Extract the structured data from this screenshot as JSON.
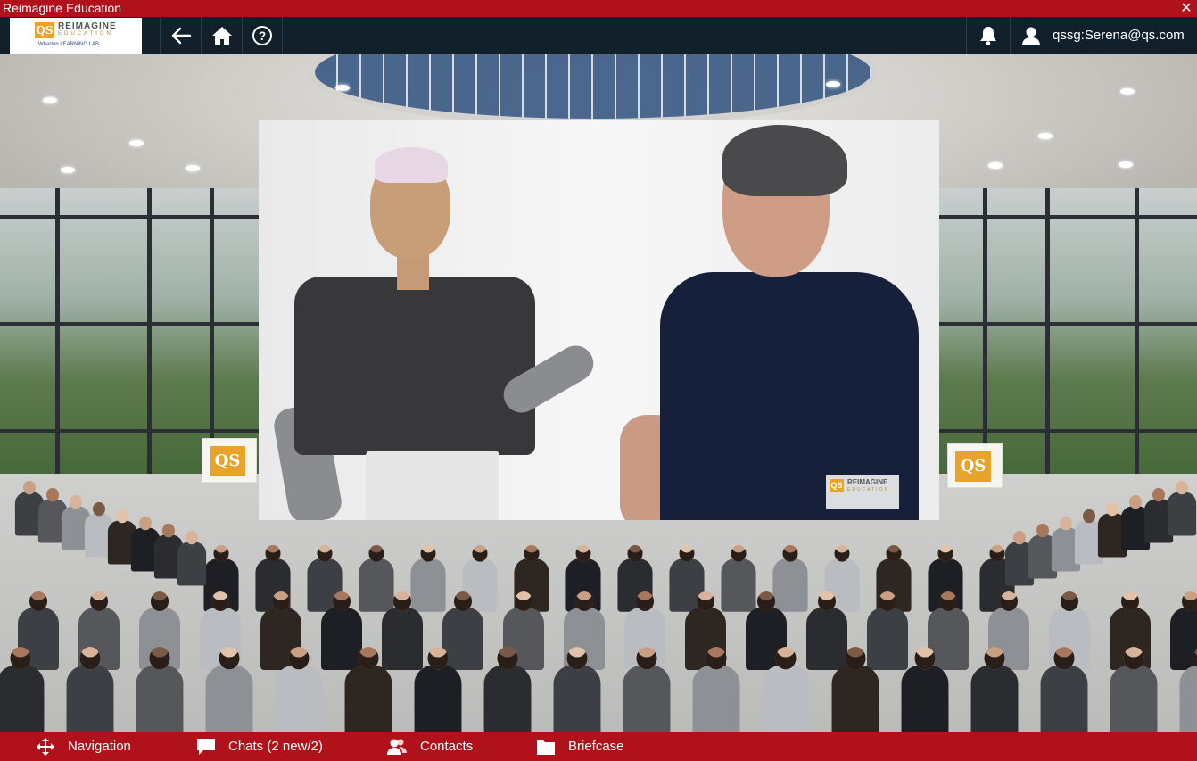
{
  "window": {
    "title": "Reimagine Education",
    "close_glyph": "✕"
  },
  "logo": {
    "qs": "QS",
    "brand": "REIMAGINE",
    "sub": "EDUCATION",
    "tag": "Wharton LEARNING LAB"
  },
  "topnav": {
    "back_icon": "back-arrow-icon",
    "home_icon": "home-icon",
    "help_icon": "help-icon",
    "notifications_icon": "bell-icon",
    "user_icon": "user-icon",
    "user_email": "qssg:Serena@qs.com"
  },
  "stage": {
    "booth_left_logo": "QS",
    "booth_right_logo": "QS",
    "video_watermark": {
      "qs": "QS",
      "brand": "REIMAGINE",
      "sub": "EDUCATION"
    }
  },
  "footer": {
    "items": [
      {
        "label": "Navigation",
        "icon": "move-icon"
      },
      {
        "label": "Chats (2 new/2)",
        "icon": "chat-icon"
      },
      {
        "label": "Contacts",
        "icon": "contacts-icon"
      },
      {
        "label": "Briefcase",
        "icon": "folder-icon"
      }
    ]
  },
  "colors": {
    "brand_red": "#b0111a",
    "nav_dark": "#12202c",
    "qs_gold": "#e8a42a"
  }
}
